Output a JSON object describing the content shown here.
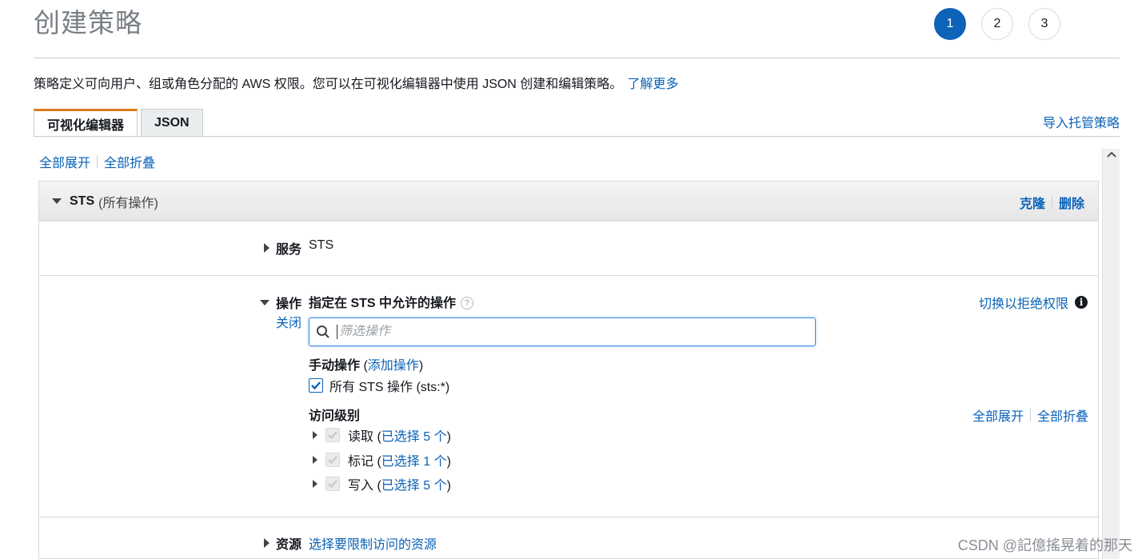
{
  "page": {
    "title": "创建策略"
  },
  "steps": [
    {
      "label": "1",
      "active": true
    },
    {
      "label": "2",
      "active": false
    },
    {
      "label": "3",
      "active": false
    }
  ],
  "intro": {
    "text": "策略定义可向用户、组或角色分配的 AWS 权限。您可以在可视化编辑器中使用 JSON 创建和编辑策略。",
    "link": "了解更多"
  },
  "tabs": [
    {
      "label": "可视化编辑器",
      "active": true
    },
    {
      "label": "JSON",
      "active": false
    }
  ],
  "import_link": "导入托管策略",
  "expand": {
    "expand_all": "全部展开",
    "collapse_all": "全部折叠"
  },
  "panel": {
    "service_name": "STS",
    "service_suffix": "(所有操作)",
    "clone": "克隆",
    "delete": "删除"
  },
  "service_row": {
    "label": "服务",
    "value": "STS"
  },
  "actions_row": {
    "label": "操作",
    "close": "关闭",
    "heading": "指定在 STS 中允许的操作",
    "switch_deny": "切换以拒绝权限",
    "search_placeholder": "筛选操作",
    "manual_label": "手动操作",
    "manual_open": "(",
    "manual_link": "添加操作",
    "manual_close": ")",
    "all_actions": "所有 STS 操作 (sts:*)",
    "access_level": "访问级别",
    "expand_all": "全部展开",
    "collapse_all": "全部折叠",
    "levels": [
      {
        "name": "读取",
        "open": " (",
        "link": "已选择 5 个",
        "close": ")"
      },
      {
        "name": "标记",
        "open": " (",
        "link": "已选择 1 个",
        "close": ")"
      },
      {
        "name": "写入",
        "open": " (",
        "link": "已选择 5 个",
        "close": ")"
      }
    ]
  },
  "resource_row": {
    "label": "资源",
    "link": "选择要限制访问的资源"
  },
  "watermark": "CSDN @記億搖晃着的那天",
  "colors": {
    "accent": "#0d63b8",
    "link": "#0a62b7",
    "tab_active_border": "#e07b1a"
  }
}
